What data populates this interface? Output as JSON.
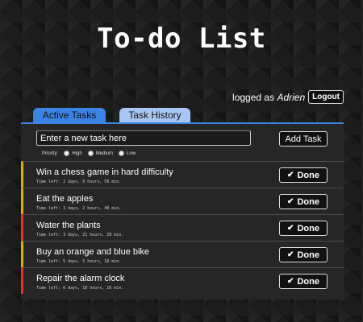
{
  "app": {
    "title": "To-do List"
  },
  "auth": {
    "prefix": "logged as",
    "user": "Adrien",
    "logout_label": "Logout"
  },
  "tabs": [
    {
      "label": "Active Tasks",
      "active": true
    },
    {
      "label": "Task History",
      "active": false
    }
  ],
  "new_task": {
    "placeholder": "Enter a new task here",
    "value": "",
    "add_label": "Add Task"
  },
  "priority": {
    "label": "Priority:",
    "options": [
      "High",
      "Medium",
      "Low"
    ]
  },
  "colors": {
    "high": "#e53030",
    "medium": "#e0b000",
    "low": "#cccccc",
    "accent": "#3b83e5"
  },
  "tasks": [
    {
      "name": "Win a chess game in hard difficulty",
      "time": "Time left: 2 days, 8 hours, 58 min.",
      "priority": "medium",
      "done_label": "Done"
    },
    {
      "name": "Eat the apples",
      "time": "Time left: 3 days, 2 hours, 48 min.",
      "priority": "medium",
      "done_label": "Done"
    },
    {
      "name": "Water the plants",
      "time": "Time left: 3 days, 21 hours, 28 min.",
      "priority": "high",
      "done_label": "Done"
    },
    {
      "name": "Buy an orange and blue bike",
      "time": "Time left: 5 days, 5 hours, 18 min.",
      "priority": "medium",
      "done_label": "Done"
    },
    {
      "name": "Repair the alarm clock",
      "time": "Time left: 6 days, 18 hours, 16 min.",
      "priority": "high",
      "done_label": "Done"
    }
  ]
}
